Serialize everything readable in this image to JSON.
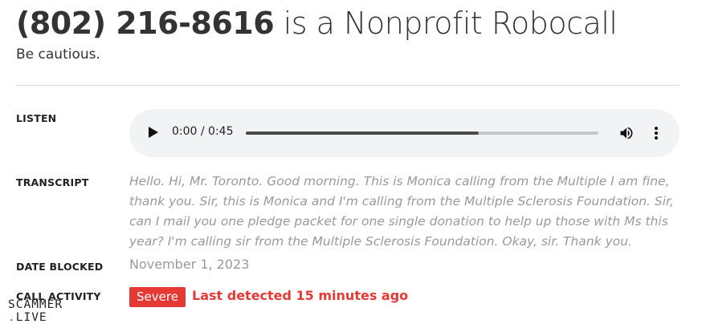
{
  "header": {
    "phone": "(802) 216-8616",
    "suffix": " is a Nonprofit Robocall",
    "subtitle": "Be cautious."
  },
  "listen": {
    "label": "LISTEN",
    "time": "0:00 / 0:45",
    "progress": 0.66,
    "play_icon": "play-icon",
    "volume_icon": "volume-icon",
    "more_icon": "more-vertical-icon"
  },
  "transcript": {
    "label": "TRANSCRIPT",
    "text": "Hello. Hi, Mr. Toronto. Good morning. This is Monica calling from the Multiple I am fine, thank you. Sir, this is Monica and I'm calling from the Multiple Sclerosis Foundation. Sir, can I mail you one pledge packet for one single donation to help up those with Ms this year? I'm calling sir from the Multiple Sclerosis Foundation. Okay, sir. Thank you."
  },
  "date_blocked": {
    "label": "DATE BLOCKED",
    "value": "November 1, 2023"
  },
  "call_activity": {
    "label": "CALL ACTIVITY",
    "badge": "Severe",
    "detected": "Last detected 15 minutes ago",
    "color": "#e53935"
  },
  "logo": {
    "line1": "SCAMMER",
    "dot": ".",
    "line2": "LIVE"
  }
}
